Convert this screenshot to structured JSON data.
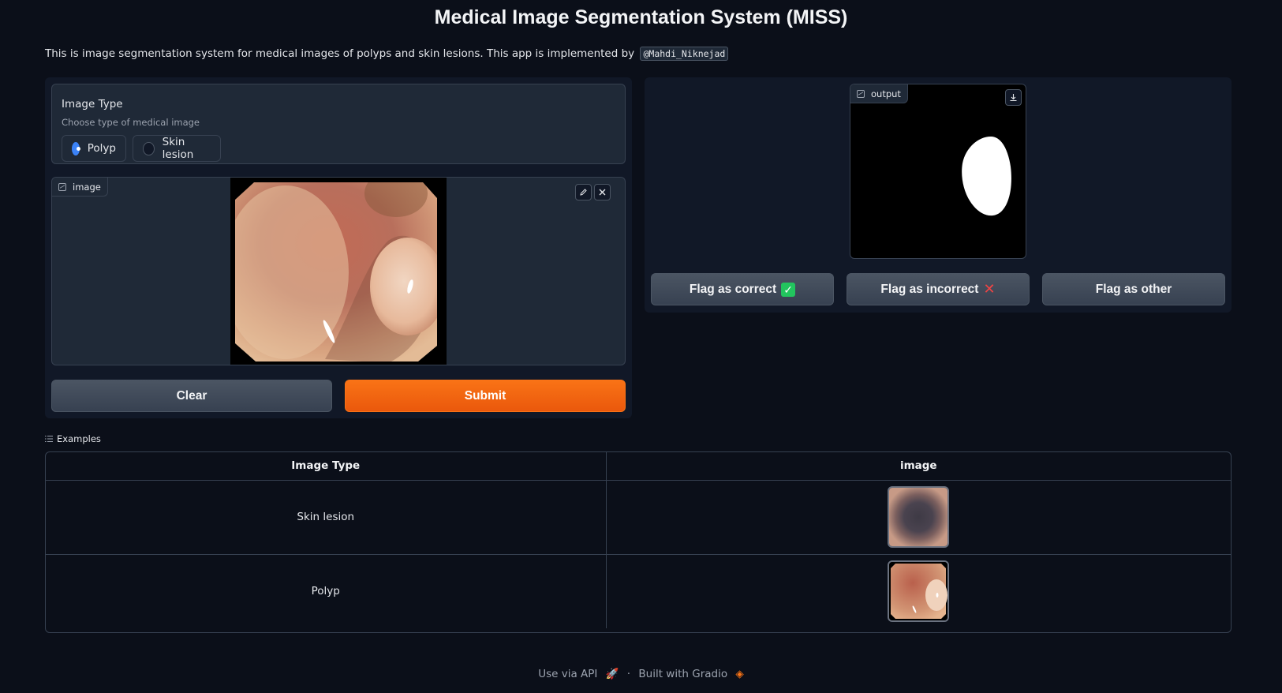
{
  "app": {
    "title": "Medical Image Segmentation System (MISS)",
    "description": "This is image segmentation system for medical images of polyps and skin lesions. This app is implemented by",
    "author_handle": "@Mahdi_Niknejad"
  },
  "input": {
    "image_type": {
      "label": "Image Type",
      "info": "Choose type of medical image",
      "options": [
        "Polyp",
        "Skin lesion"
      ],
      "selected": "Polyp"
    },
    "image_label": "image",
    "edit_icon": "pencil-icon",
    "remove_icon": "close-icon"
  },
  "output": {
    "label": "output",
    "download_icon": "download-icon"
  },
  "buttons": {
    "clear": "Clear",
    "submit": "Submit",
    "flag_correct": "Flag as correct",
    "flag_incorrect": "Flag as incorrect",
    "flag_other": "Flag as other"
  },
  "examples": {
    "label": "Examples",
    "headers": [
      "Image Type",
      "image"
    ],
    "rows": [
      {
        "image_type": "Skin lesion",
        "thumb": "skin-lesion-thumbnail"
      },
      {
        "image_type": "Polyp",
        "thumb": "polyp-thumbnail"
      }
    ]
  },
  "footer": {
    "api": "Use via API",
    "separator": "·",
    "built": "Built with Gradio"
  },
  "colors": {
    "background": "#0b0f19",
    "panel": "#111827",
    "block": "#1f2937",
    "primary": "#f97316",
    "radio_selected": "#3b82f6"
  }
}
